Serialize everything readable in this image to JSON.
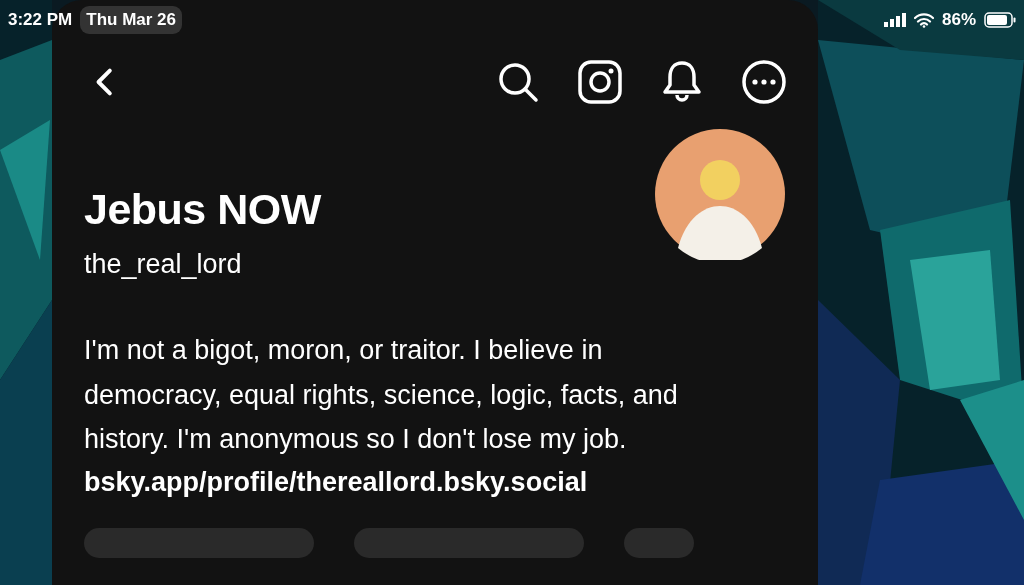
{
  "status_bar": {
    "time": "3:22 PM",
    "date": "Thu Mar 26",
    "battery": "86%"
  },
  "header": {
    "icons": [
      {
        "kind": "search"
      },
      {
        "kind": "camera"
      },
      {
        "kind": "bell"
      },
      {
        "kind": "more"
      }
    ]
  },
  "profile": {
    "display_name": "Jebus NOW",
    "handle": "the_real_lord",
    "bio": "I'm not a bigot, moron, or traitor. I believe in democracy, equal rights, science, logic, facts, and history. I'm anonymous so I don't lose my job.",
    "link": "bsky.app/profile/thereallord.bsky.social"
  }
}
